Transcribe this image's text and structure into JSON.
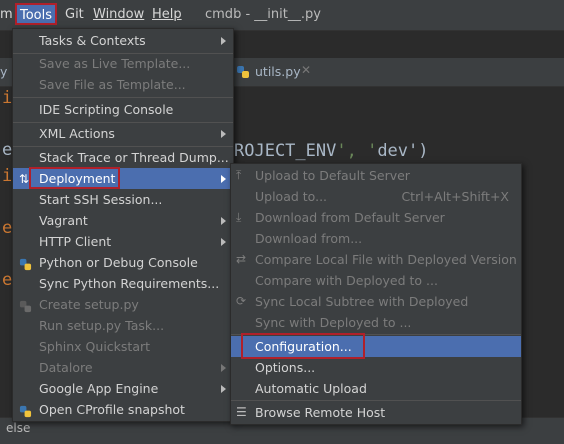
{
  "menubar": {
    "partial_item": "m",
    "tools": "Tools",
    "git": "Git",
    "window": "Window",
    "help": "Help",
    "title": "cmdb - __init__.py"
  },
  "editor": {
    "tab_partial": "y",
    "tab_label": "utils.py",
    "code_fragment": "ROJECT_ENV', 'dev')",
    "gutter_letters": [
      "i",
      "e",
      "i",
      "e",
      "e"
    ]
  },
  "status_bar": {
    "text": "else"
  },
  "tools_menu": {
    "items": [
      {
        "label": "Tasks & Contexts",
        "submenu": true,
        "disabled": false
      },
      {
        "label": "Save as Live Template...",
        "submenu": false,
        "disabled": true
      },
      {
        "label": "Save File as Template...",
        "submenu": false,
        "disabled": true
      },
      {
        "label": "IDE Scripting Console",
        "submenu": false,
        "disabled": false
      },
      {
        "label": "XML Actions",
        "submenu": true,
        "disabled": false
      },
      {
        "label": "Stack Trace or Thread Dump...",
        "submenu": false,
        "disabled": false
      },
      {
        "label": "Deployment",
        "submenu": true,
        "disabled": false
      },
      {
        "label": "Start SSH Session...",
        "submenu": false,
        "disabled": false
      },
      {
        "label": "Vagrant",
        "submenu": true,
        "disabled": false
      },
      {
        "label": "HTTP Client",
        "submenu": true,
        "disabled": false
      },
      {
        "label": "Python or Debug Console",
        "submenu": false,
        "disabled": false
      },
      {
        "label": "Sync Python Requirements...",
        "submenu": false,
        "disabled": false
      },
      {
        "label": "Create setup.py",
        "submenu": false,
        "disabled": true
      },
      {
        "label": "Run setup.py Task...",
        "submenu": false,
        "disabled": true
      },
      {
        "label": "Sphinx Quickstart",
        "submenu": false,
        "disabled": true
      },
      {
        "label": "Datalore",
        "submenu": true,
        "disabled": true
      },
      {
        "label": "Google App Engine",
        "submenu": true,
        "disabled": false
      },
      {
        "label": "Open CProfile snapshot",
        "submenu": false,
        "disabled": false
      }
    ]
  },
  "deployment_menu": {
    "items": [
      {
        "label": "Upload to Default Server",
        "shortcut": "",
        "disabled": true,
        "icon": "upload-icon"
      },
      {
        "label": "Upload to...",
        "shortcut": "Ctrl+Alt+Shift+X",
        "disabled": true,
        "icon": ""
      },
      {
        "label": "Download from Default Server",
        "shortcut": "",
        "disabled": true,
        "icon": "download-icon"
      },
      {
        "label": "Download from...",
        "shortcut": "",
        "disabled": true,
        "icon": ""
      },
      {
        "label": "Compare Local File with Deployed Version",
        "shortcut": "",
        "disabled": true,
        "icon": "compare-icon"
      },
      {
        "label": "Compare with Deployed to ...",
        "shortcut": "",
        "disabled": true,
        "icon": ""
      },
      {
        "label": "Sync Local Subtree with Deployed",
        "shortcut": "",
        "disabled": true,
        "icon": "sync-icon"
      },
      {
        "label": "Sync with Deployed to ...",
        "shortcut": "",
        "disabled": true,
        "icon": ""
      },
      {
        "label": "Configuration...",
        "shortcut": "",
        "disabled": false,
        "icon": ""
      },
      {
        "label": "Options...",
        "shortcut": "",
        "disabled": false,
        "icon": ""
      },
      {
        "label": "Automatic Upload",
        "shortcut": "",
        "disabled": false,
        "icon": ""
      },
      {
        "label": "Browse Remote Host",
        "shortcut": "",
        "disabled": false,
        "icon": "remote-host-icon"
      }
    ]
  },
  "colors": {
    "highlight": "#4b6eaf",
    "annotation_box": "#b0202a",
    "menu_bg": "#3c3f41",
    "editor_bg": "#2b2b2b"
  }
}
